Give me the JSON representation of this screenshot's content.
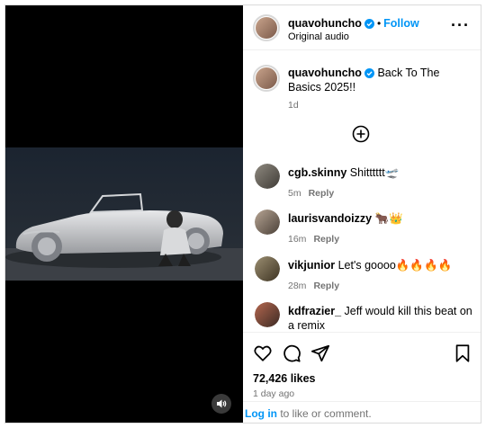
{
  "post": {
    "username": "quavohuncho",
    "follow_label": "Follow",
    "audio_label": "Original audio",
    "caption_text": "Back To The Basics 2025!!",
    "caption_age": "1d"
  },
  "comments": [
    {
      "username": "cgb.skinny",
      "text": "Shitttttt🛫",
      "age": "5m",
      "reply_label": "Reply"
    },
    {
      "username": "laurisvandoizzy",
      "text": "🐂👑",
      "age": "16m",
      "reply_label": "Reply"
    },
    {
      "username": "vikjunior",
      "text": "Let's goooo🔥🔥🔥🔥",
      "age": "28m",
      "reply_label": "Reply"
    },
    {
      "username": "kdfrazier_",
      "text": "Jeff would kill this beat on a remix",
      "age": "",
      "reply_label": ""
    }
  ],
  "engagement": {
    "likes": "72,426 likes",
    "date": "1 day ago"
  },
  "login_prompt": {
    "link_text": "Log in",
    "rest_text": " to like or comment."
  },
  "icons": {
    "like": "heart-icon",
    "comment": "comment-icon",
    "share": "share-icon",
    "save": "bookmark-icon",
    "more": "more-options-icon",
    "add": "add-comment-icon",
    "mute": "speaker-icon",
    "verified": "verified-badge-icon"
  },
  "colors": {
    "accent": "#0095f6",
    "verified": "#0095f6",
    "muted_text": "#737373",
    "media_bg": "#000000"
  }
}
